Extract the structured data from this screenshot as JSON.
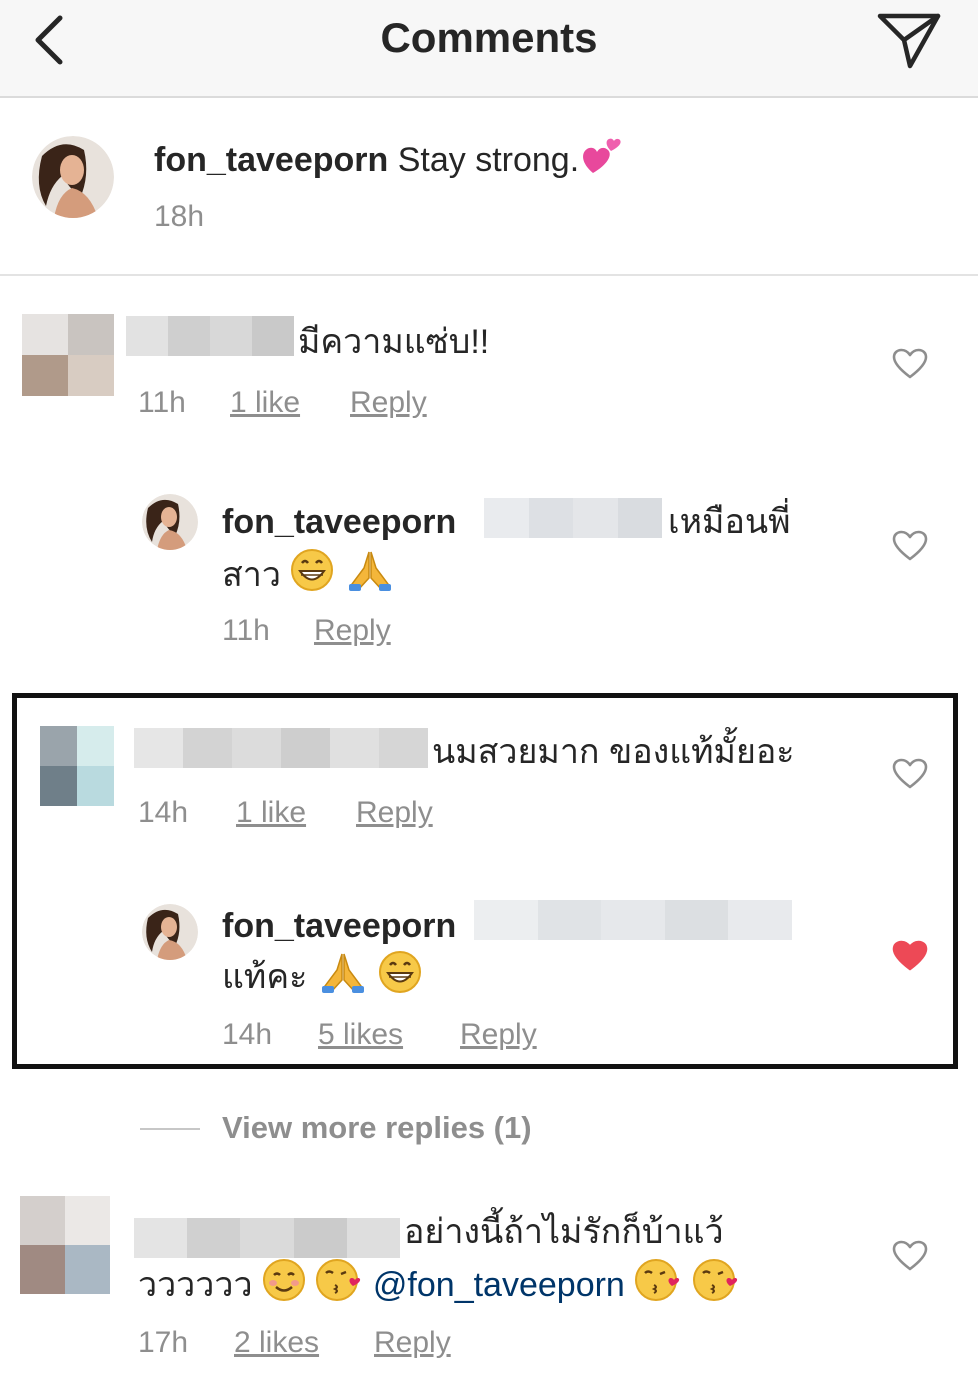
{
  "header": {
    "title": "Comments"
  },
  "caption": {
    "username": "fon_taveeporn",
    "text": "Stay strong.",
    "emoji": "two-hearts-emoji",
    "time": "18h"
  },
  "comments": [
    {
      "text": "มีความแซ่บ!!",
      "time": "11h",
      "likes": "1 like",
      "reply": "Reply",
      "liked": false,
      "reply_comment": {
        "username": "fon_taveeporn",
        "text_line1": "เหมือนพี่",
        "text_line2": "สาว",
        "time": "11h",
        "reply": "Reply",
        "liked": false
      }
    },
    {
      "text": "นมสวยมาก ของแท้มั้ยอะ",
      "time": "14h",
      "likes": "1 like",
      "reply": "Reply",
      "liked": false,
      "reply_comment": {
        "username": "fon_taveeporn",
        "text_line2": "แท้คะ",
        "time": "14h",
        "likes": "5 likes",
        "reply": "Reply",
        "liked": true
      }
    },
    {
      "text_line1": "อย่างนี้ถ้าไม่รักก็บ้าแว้",
      "text_line2": "วววววว",
      "mention": "@fon_taveeporn",
      "time": "17h",
      "likes": "2 likes",
      "reply": "Reply",
      "liked": false
    }
  ],
  "view_more": "View more replies (1)",
  "colors": {
    "liked_heart": "#ed4956",
    "muted_text": "#8e8e8e",
    "mention": "#003569"
  }
}
